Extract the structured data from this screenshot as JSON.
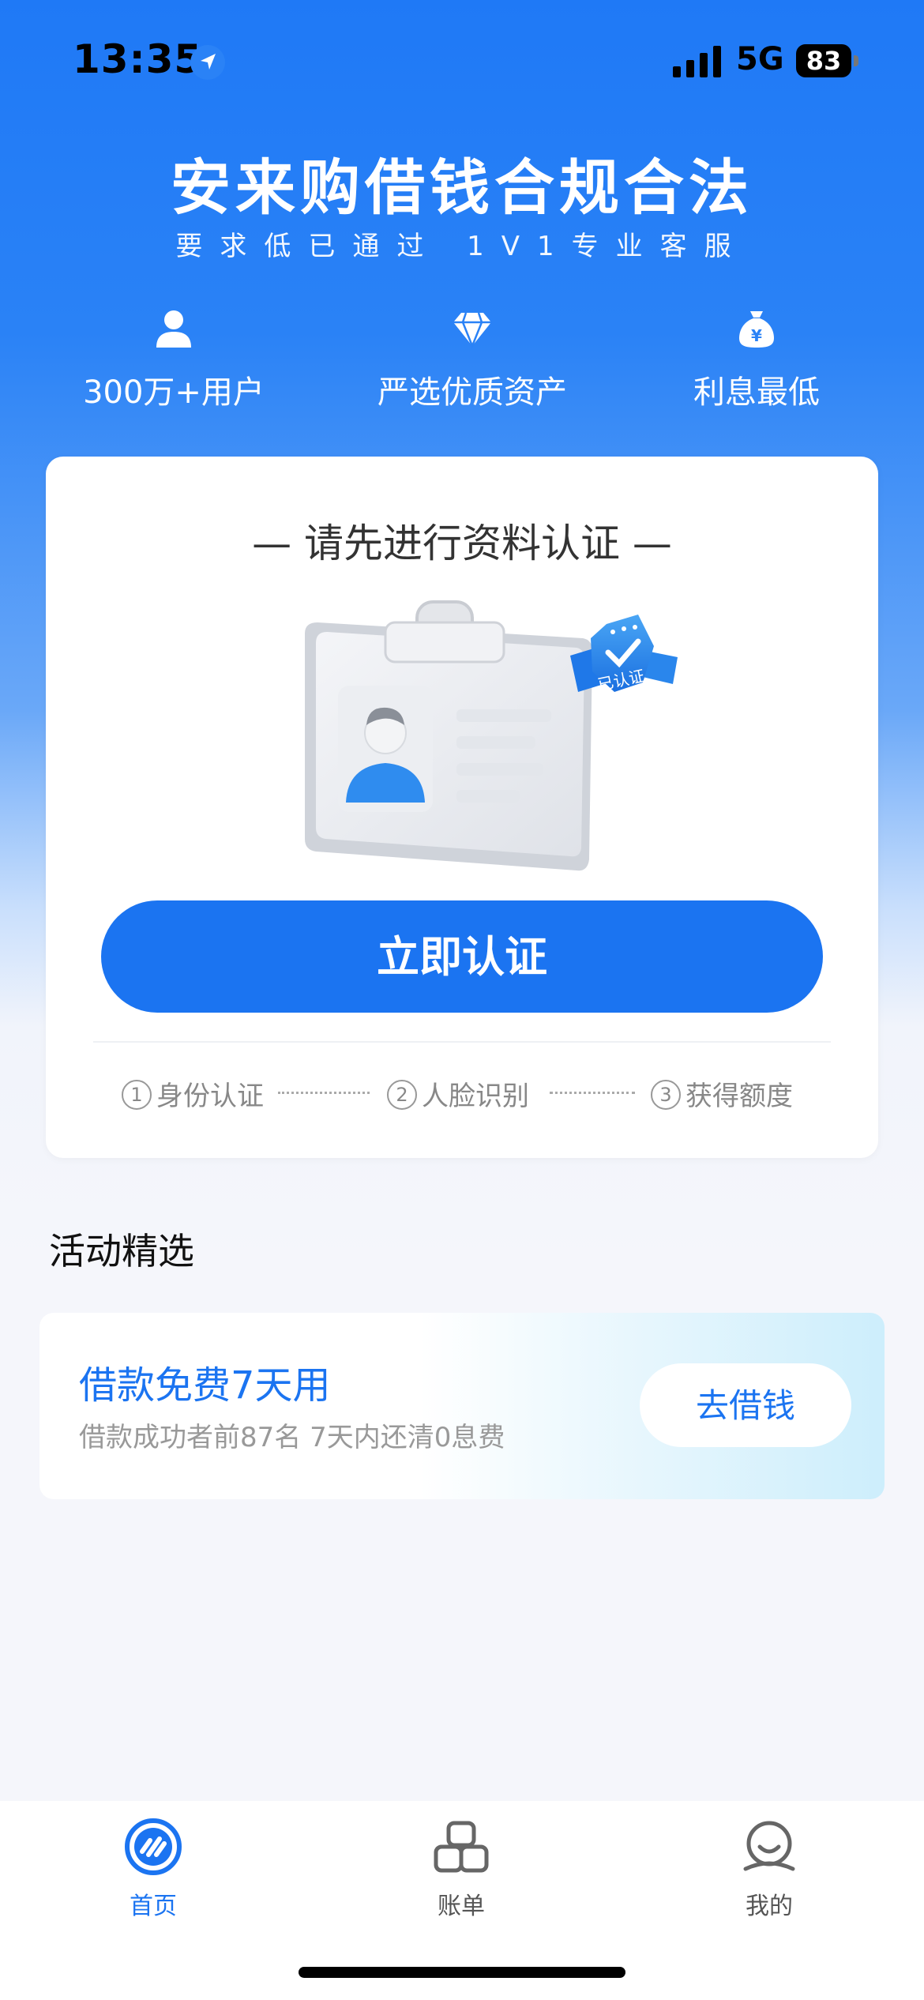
{
  "status_bar": {
    "time": "13:35",
    "network": "5G",
    "battery": "83"
  },
  "hero": {
    "title": "安来购借钱合规合法",
    "subtitle": "要求低已通过 1V1专业客服",
    "features": [
      {
        "icon": "user-icon",
        "label": "300万+用户"
      },
      {
        "icon": "diamond-icon",
        "label": "严选优质资产"
      },
      {
        "icon": "money-bag-icon",
        "label": "利息最低"
      }
    ]
  },
  "auth_card": {
    "title": "— 请先进行资料认证 —",
    "badge_text": "已认证",
    "button_label": "立即认证",
    "steps": [
      {
        "num": "1",
        "label": "身份认证"
      },
      {
        "num": "2",
        "label": "人脸识别"
      },
      {
        "num": "3",
        "label": "获得额度"
      }
    ]
  },
  "activities": {
    "section_title": "活动精选",
    "promo": {
      "title": "借款免费7天用",
      "subtitle": "借款成功者前87名 7天内还清0息费",
      "button_label": "去借钱"
    }
  },
  "tabbar": {
    "tabs": [
      {
        "icon": "home-icon",
        "label": "首页",
        "active": true
      },
      {
        "icon": "bills-icon",
        "label": "账单",
        "active": false
      },
      {
        "icon": "profile-icon",
        "label": "我的",
        "active": false
      }
    ]
  },
  "colors": {
    "primary": "#1b74f1",
    "hero_top": "#1f79f6",
    "background": "#f5f6fb"
  }
}
